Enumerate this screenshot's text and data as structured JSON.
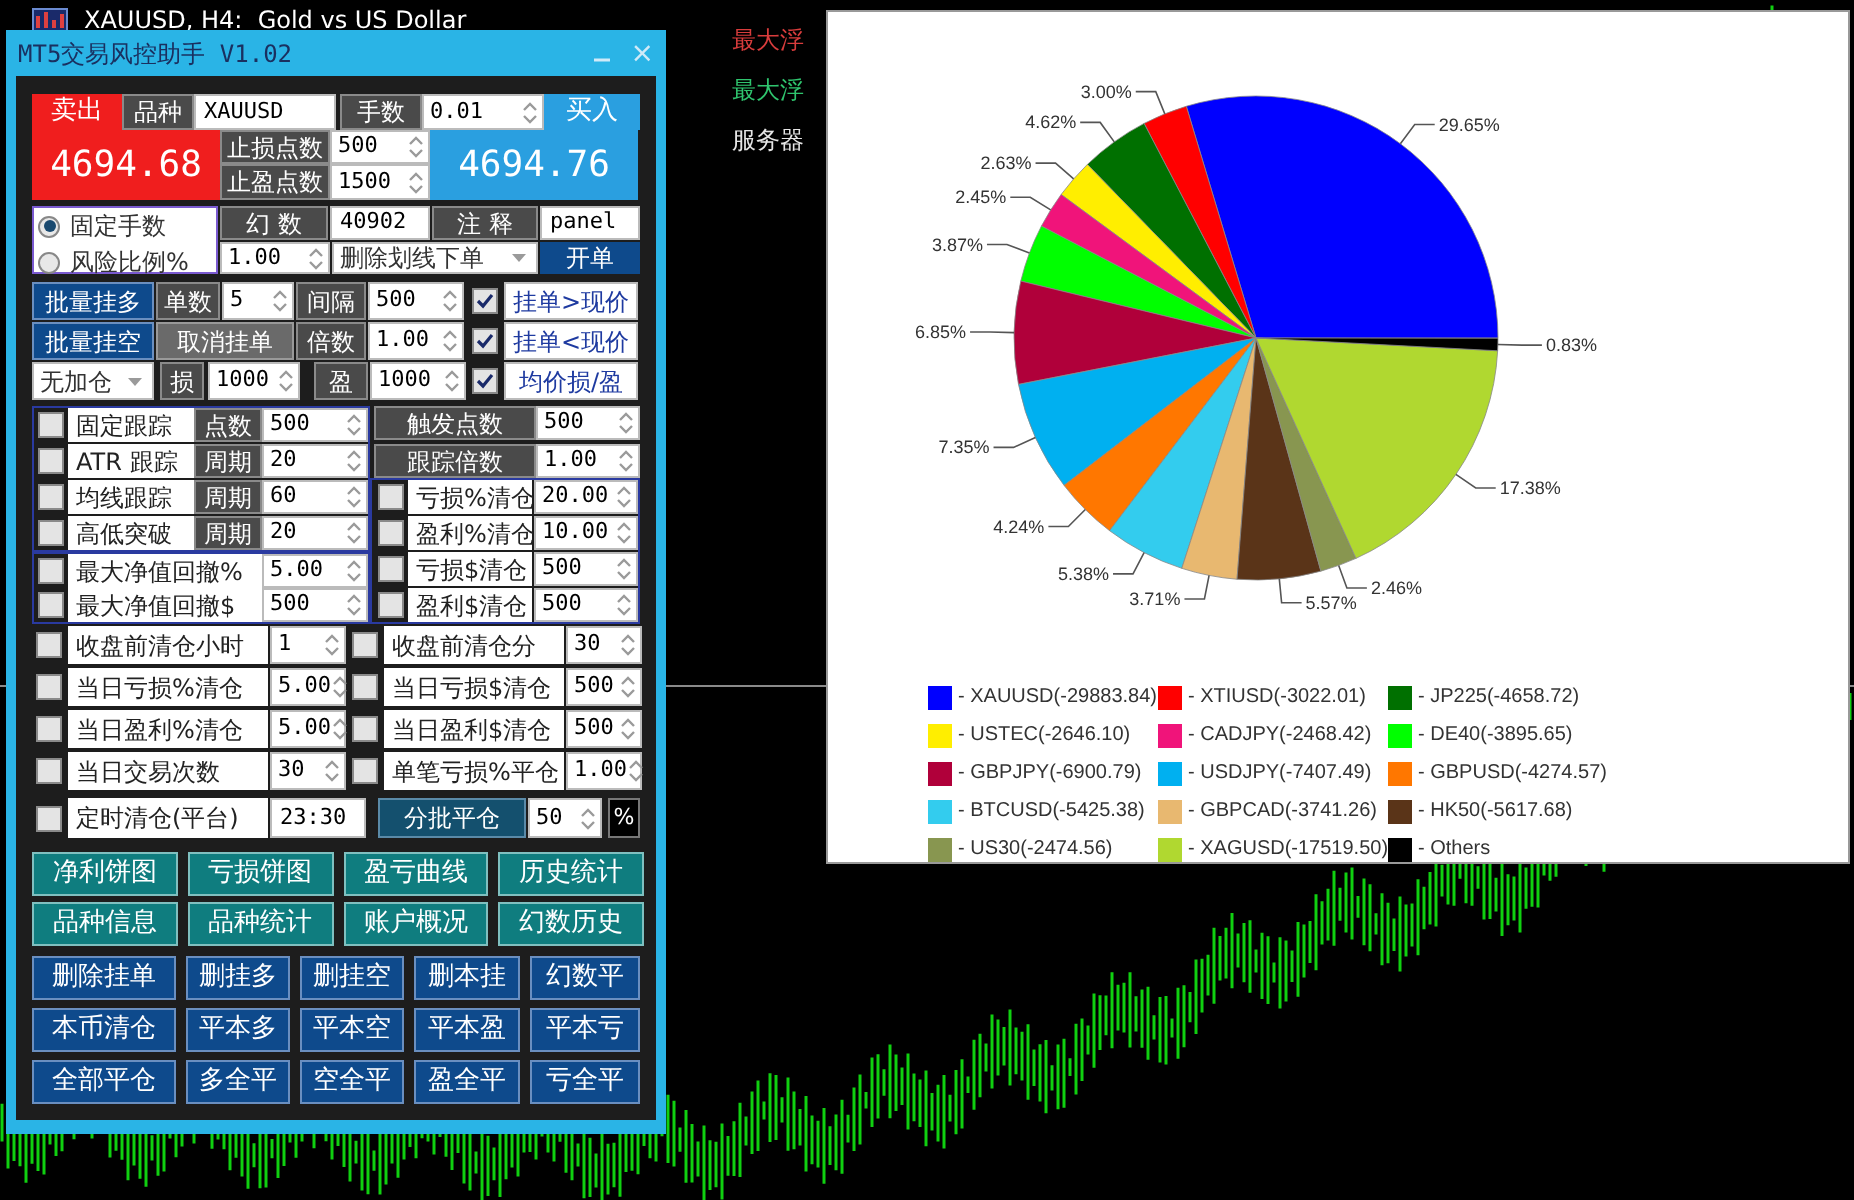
{
  "chart": {
    "title": "XAUUSD, H4:  Gold vs US Dollar",
    "side_labels": [
      {
        "text": "最大浮",
        "color": "#d83c3c"
      },
      {
        "text": "最大浮",
        "color": "#2fc46e"
      },
      {
        "text": "服务器",
        "color": "#e6e6e6"
      }
    ]
  },
  "panel": {
    "title": "MT5交易风控助手 V1.02",
    "close": "×"
  },
  "trade": {
    "sell": "卖出",
    "symbol_tag": "品种",
    "symbol": "XAUUSD",
    "lots_tag": "手数",
    "lots": "0.01",
    "buy": "买入",
    "bid": "4694.68",
    "sl_tag": "止损点数",
    "sl": "500",
    "tp_tag": "止盈点数",
    "tp": "1500",
    "ask": "4694.76"
  },
  "lot_mode": {
    "options": [
      {
        "label": "固定手数",
        "selected": true
      },
      {
        "label": "风险比例%",
        "selected": false
      }
    ],
    "risk": "1.00",
    "magic_tag": "幻 数",
    "magic": "40902",
    "comment_tag": "注 释",
    "comment": "panel",
    "order_mode": "删除划线下单",
    "open": "开单"
  },
  "batch": {
    "buy_stop": "批量挂多",
    "count_tag": "单数",
    "count": "5",
    "gap_tag": "间隔",
    "gap": "500",
    "above_checked": true,
    "above": "挂单>现价",
    "sell_stop": "批量挂空",
    "cancel": "取消挂单",
    "mult_tag": "倍数",
    "mult": "1.00",
    "below_checked": true,
    "below": "挂单<现价",
    "add_mode": "无加仓",
    "sl_tag": "损",
    "sl": "1000",
    "tp_tag": "盈",
    "tp": "1000",
    "avg_checked": true,
    "avg": "均价损/盈"
  },
  "trailing": {
    "rows": [
      {
        "checked": false,
        "label": "固定跟踪",
        "tag": "点数",
        "value": "500"
      },
      {
        "checked": false,
        "label": "ATR 跟踪",
        "tag": "周期",
        "value": "20"
      },
      {
        "checked": false,
        "label": "均线跟踪",
        "tag": "周期",
        "value": "60"
      },
      {
        "checked": false,
        "label": "高低突破",
        "tag": "周期",
        "value": "20"
      }
    ],
    "settings": [
      {
        "tag": "触发点数",
        "value": "500"
      },
      {
        "tag": "跟踪倍数",
        "value": "1.00"
      }
    ]
  },
  "drawdown": [
    {
      "checked": false,
      "label": "最大净值回撤%",
      "value": "5.00"
    },
    {
      "checked": false,
      "label": "最大净值回撤$",
      "value": "500"
    }
  ],
  "profit_close": [
    {
      "checked": false,
      "label": "亏损%清仓",
      "value": "20.00"
    },
    {
      "checked": false,
      "label": "盈利%清仓",
      "value": "10.00"
    },
    {
      "checked": false,
      "label": "亏损$清仓",
      "value": "500"
    },
    {
      "checked": false,
      "label": "盈利$清仓",
      "value": "500"
    }
  ],
  "daily": [
    {
      "checked": false,
      "label": "收盘前清仓小时",
      "value": "1"
    },
    {
      "checked": false,
      "label": "收盘前清仓分",
      "value": "30"
    },
    {
      "checked": false,
      "label": "当日亏损%清仓",
      "value": "5.00"
    },
    {
      "checked": false,
      "label": "当日亏损$清仓",
      "value": "500"
    },
    {
      "checked": false,
      "label": "当日盈利%清仓",
      "value": "5.00"
    },
    {
      "checked": false,
      "label": "当日盈利$清仓",
      "value": "500"
    },
    {
      "checked": false,
      "label": "当日交易次数",
      "value": "30"
    },
    {
      "checked": false,
      "label": "单笔亏损%平仓",
      "value": "1.00"
    }
  ],
  "timer": {
    "checked": false,
    "label": "定时清仓(平台)",
    "time": "23:30",
    "split": "分批平仓",
    "split_value": "50",
    "unit": "%"
  },
  "reports": [
    "净利饼图",
    "亏损饼图",
    "盈亏曲线",
    "历史统计",
    "品种信息",
    "品种统计",
    "账户概况",
    "幻数历史"
  ],
  "actions": [
    "删除挂单",
    "删挂多",
    "删挂空",
    "删本挂",
    "幻数平",
    "本币清仓",
    "平本多",
    "平本空",
    "平本盈",
    "平本亏",
    "全部平仓",
    "多全平",
    "空全平",
    "盈全平",
    "亏全平"
  ],
  "pie_window": {
    "chart_data": {
      "type": "pie",
      "values": [
        29.65,
        3.0,
        4.62,
        2.63,
        2.45,
        3.87,
        6.85,
        7.35,
        4.24,
        5.38,
        3.71,
        5.57,
        2.46,
        17.38,
        0.83
      ],
      "value_labels": [
        "29.65%",
        "3.00%",
        "4.62%",
        "2.63%",
        "2.45%",
        "3.87%",
        "6.85%",
        "7.35%",
        "4.24%",
        "5.38%",
        "3.71%",
        "5.57%",
        "2.46%",
        "17.38%",
        "0.83%"
      ]
    },
    "legend": [
      {
        "label": "- XAUUSD(-29883.84)",
        "color": "#0000ff"
      },
      {
        "label": "- XTIUSD(-3022.01)",
        "color": "#ff0000"
      },
      {
        "label": "- JP225(-4658.72)",
        "color": "#007000"
      },
      {
        "label": "- USTEC(-2646.10)",
        "color": "#ffee00"
      },
      {
        "label": "- CADJPY(-2468.42)",
        "color": "#f0147a"
      },
      {
        "label": "- DE40(-3895.65)",
        "color": "#00ff00"
      },
      {
        "label": "- GBPJPY(-6900.79)",
        "color": "#b0003a"
      },
      {
        "label": "- USDJPY(-7407.49)",
        "color": "#00b0f0"
      },
      {
        "label": "- GBPUSD(-4274.57)",
        "color": "#ff7700"
      },
      {
        "label": "- BTCUSD(-5425.38)",
        "color": "#33ccee"
      },
      {
        "label": "- GBPCAD(-3741.26)",
        "color": "#e8b870"
      },
      {
        "label": "- HK50(-5617.68)",
        "color": "#5a3418"
      },
      {
        "label": "- US30(-2474.56)",
        "color": "#889650"
      },
      {
        "label": "- XAGUSD(-17519.50)",
        "color": "#b0d830"
      },
      {
        "label": "- Others",
        "color": "#000000"
      }
    ]
  }
}
